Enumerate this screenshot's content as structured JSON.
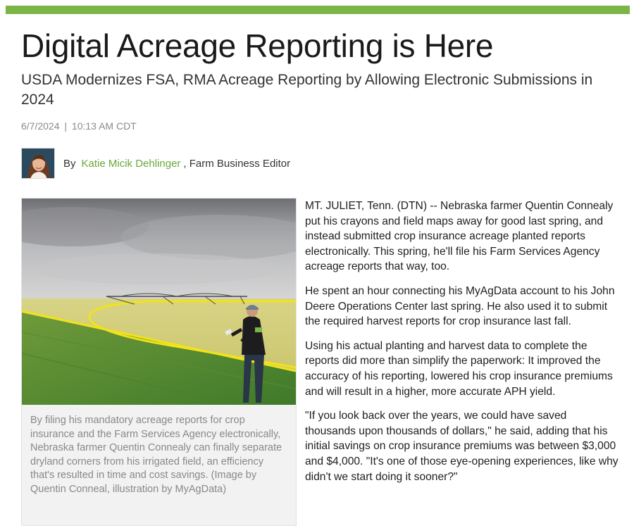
{
  "article": {
    "headline": "Digital Acreage Reporting is Here",
    "subhead": "USDA Modernizes FSA, RMA Acreage Reporting by Allowing Electronic Submissions in 2024",
    "date": "6/7/2024",
    "separator": "|",
    "time": "10:13 AM CDT",
    "byline_prefix": "By",
    "author": "Katie Micik Dehlinger",
    "author_role": ", Farm Business Editor",
    "image_caption": "By filing his mandatory acreage reports for crop insurance and the Farm Services Agency electronically, Nebraska farmer Quentin Connealy can finally separate dryland corners from his irrigated field, an efficiency that's resulted in time and cost savings. (Image by Quentin Conneal, illustration by MyAgData)",
    "paragraphs": [
      "MT. JULIET, Tenn. (DTN) -- Nebraska farmer Quentin Connealy put his crayons and field maps away for good last spring, and instead submitted crop insurance acreage planted reports electronically. This spring, he'll file his Farm Services Agency acreage reports that way, too.",
      "He spent an hour connecting his MyAgData account to his John Deere Operations Center last spring. He also used it to submit the required harvest reports for crop insurance last fall.",
      "Using his actual planting and harvest data to complete the reports did more than simplify the paperwork: It improved the accuracy of his reporting, lowered his crop insurance premiums and will result in a higher, more accurate APH yield.",
      "\"If you look back over the years, we could have saved thousands upon thousands of dollars,\" he said, adding that his initial savings on crop insurance premiums was between $3,000 and $4,000. \"It's one of those eye-opening experiences, like why didn't we start doing it sooner?\""
    ]
  },
  "colors": {
    "accent": "#7bb547",
    "author_link": "#6aa83e",
    "caption_text": "#888888",
    "field_outline": "#f2e21a"
  }
}
